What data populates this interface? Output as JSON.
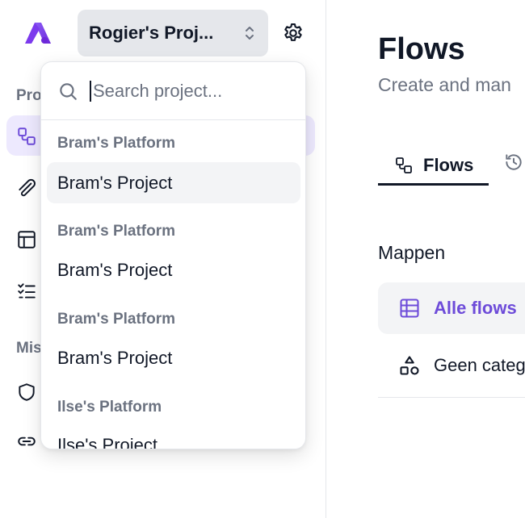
{
  "sidebar": {
    "project_selector": "Rogier's Proj...",
    "sections": [
      "Pro",
      "Mis"
    ]
  },
  "dropdown": {
    "search_placeholder": "Search project...",
    "groups": [
      {
        "platform": "Bram's Platform",
        "project": "Bram's Project"
      },
      {
        "platform": "Bram's Platform",
        "project": "Bram's Project"
      },
      {
        "platform": "Bram's Platform",
        "project": "Bram's Project"
      },
      {
        "platform": "Ilse's Platform",
        "project": "Ilse's Project"
      }
    ]
  },
  "main": {
    "title": "Flows",
    "subtitle": "Create and man",
    "tabs": [
      {
        "label": "Flows"
      }
    ],
    "folders_heading": "Mappen",
    "folders": [
      {
        "label": "Alle flows"
      },
      {
        "label": "Geen categ"
      }
    ]
  },
  "colors": {
    "accent": "#6d4bd9",
    "active_bg": "#ede9fe",
    "muted_text": "#6b7280"
  }
}
